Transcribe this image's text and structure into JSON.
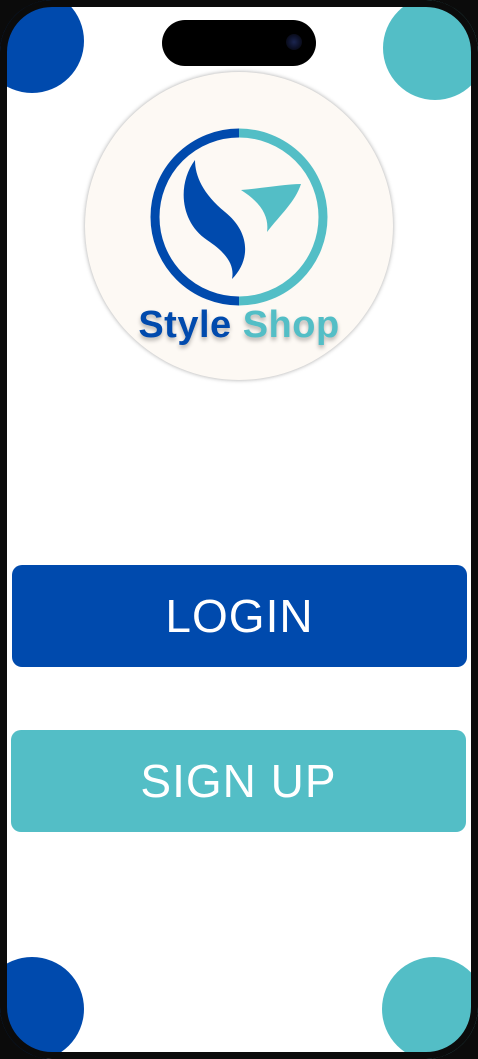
{
  "colors": {
    "primary": "#004aad",
    "accent": "#53bec6",
    "logo_bg": "#fdf9f4",
    "button_text": "#ffffff"
  },
  "logo": {
    "brand_word_1": "Style",
    "brand_word_2": "Shop",
    "icon": "style-shop-logo-icon"
  },
  "buttons": {
    "login_label": "LOGIN",
    "signup_label": "SIGN UP"
  },
  "device": {
    "notch": "dynamic-island",
    "camera_icon": "camera-icon"
  }
}
